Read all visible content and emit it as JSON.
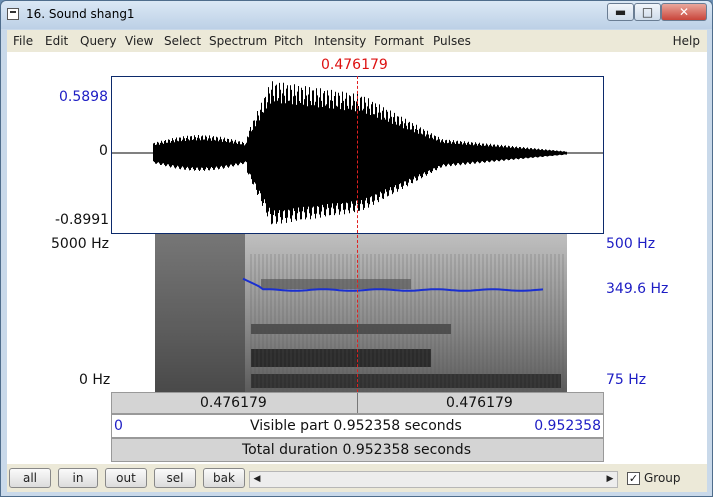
{
  "window": {
    "title": "16. Sound shang1",
    "minimize_glyph": "▬",
    "maximize_glyph": "□",
    "close_glyph": "✕"
  },
  "menu": {
    "items": [
      "File",
      "Edit",
      "Query",
      "View",
      "Select",
      "Spectrum",
      "Pitch",
      "Intensity",
      "Formant",
      "Pulses"
    ],
    "help": "Help"
  },
  "cursor": {
    "time": "0.476179"
  },
  "waveform": {
    "max_label": "0.5898",
    "zero_label": "0",
    "min_label": "-0.8991"
  },
  "spectrogram": {
    "top_label": "5000 Hz",
    "bottom_label": "0 Hz",
    "pitch_top_label": "500 Hz",
    "pitch_value_label": "349.6 Hz",
    "pitch_bottom_label": "75 Hz"
  },
  "time_bar": {
    "left": "0.476179",
    "right": "0.476179"
  },
  "visible_bar": {
    "start": "0",
    "text": "Visible part 0.952358 seconds",
    "end": "0.952358"
  },
  "total_bar": {
    "text": "Total duration 0.952358 seconds"
  },
  "bottom": {
    "buttons": [
      "all",
      "in",
      "out",
      "sel",
      "bak"
    ],
    "scroll_left": "◀",
    "scroll_right": "▶",
    "group_checked": "✓",
    "group_label": "Group"
  },
  "colors": {
    "pitch_curve": "#1a2fd0",
    "cursor": "#e02020",
    "waveform": "#000000"
  }
}
